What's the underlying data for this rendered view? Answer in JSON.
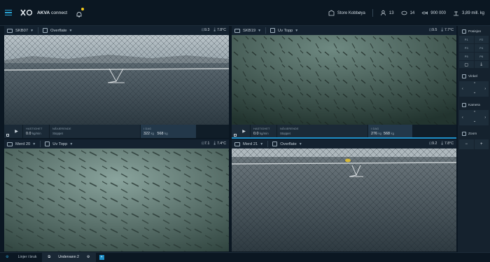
{
  "app": {
    "brand": "AKVA",
    "product": "connect"
  },
  "topbar": {
    "site": "Store Kobbøya",
    "people": "13",
    "cameras": "14",
    "fish_count": "900 000",
    "biomass": "3,89 mill. kg"
  },
  "panes": [
    {
      "name": "SKB07",
      "view": "Overflate",
      "m1": "9.3",
      "m2": "7.8",
      "unit": "°C",
      "speed_label": "HASTIGHET",
      "speed": "0.0",
      "speed_unit": "kg/min",
      "state_label": "NÅVÆRENDE",
      "state": "Stoppet",
      "feed_label": "I DAG",
      "feed_now": "322",
      "feed_total": "568",
      "kg": "kg"
    },
    {
      "name": "SKB19",
      "view": "Uv Topp",
      "m1": "9.5",
      "m2": "7.7",
      "unit": "°C",
      "speed_label": "HASTIGHET",
      "speed": "0.0",
      "speed_unit": "kg/min",
      "state_label": "NÅVÆRENDE",
      "state": "Stoppet",
      "feed_label": "I DAG",
      "feed_now": "276",
      "feed_total": "568",
      "kg": "kg"
    },
    {
      "name": "Merd 20",
      "view": "Uv Topp",
      "m1": "7.1",
      "m2": "7.4",
      "unit": "°C"
    },
    {
      "name": "Merd 21",
      "view": "Overflate",
      "m1": "9.2",
      "m2": "7.8",
      "unit": "°C"
    }
  ],
  "sidebar": {
    "position_label": "Posisjon",
    "presets": [
      "P1",
      "P2",
      "P3",
      "P4",
      "P5",
      "P6"
    ],
    "angle_label": "Vinkel",
    "camera_label": "Kamera",
    "zoom_label": "Zoom",
    "zoom_minus": "−",
    "zoom_plus": "+"
  },
  "bottom": {
    "tab1": "Linjer i bruk",
    "tab2": "Undervann 2",
    "add": "+"
  },
  "colors": {
    "accent": "#1e8fc7",
    "notification": "#f2c81b",
    "background": "#0b1722"
  }
}
